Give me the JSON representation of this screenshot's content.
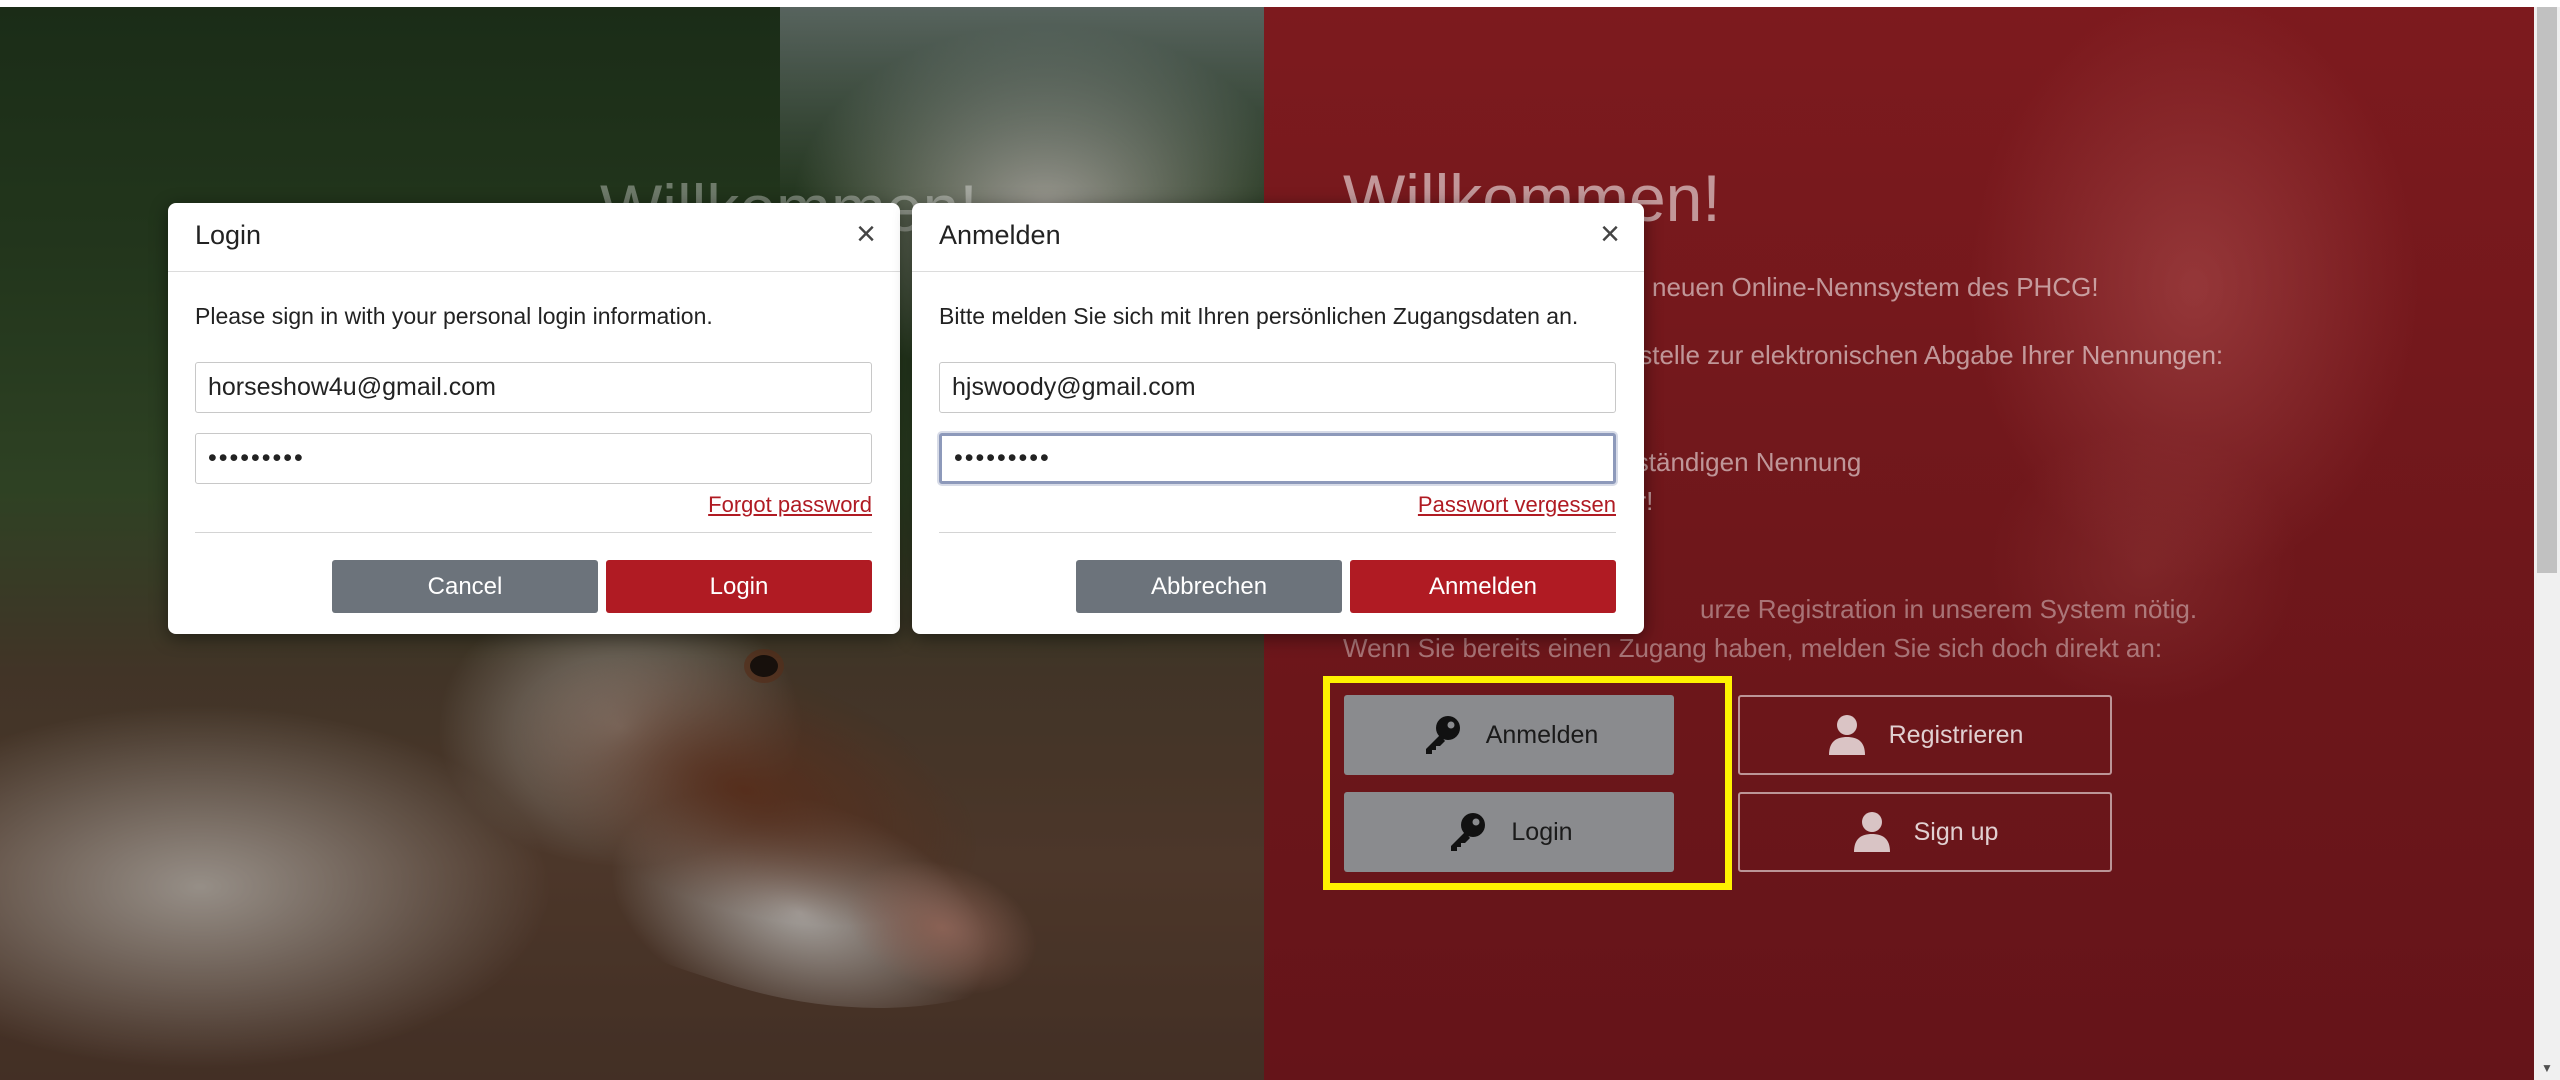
{
  "background": {
    "left_title": "Willkommen!",
    "welcome_title": "Willkommen!",
    "welcome_lines": [
      "neuen Online-Nennsystem des PHCG!",
      "fstelle zur elektronischen Abgabe Ihrer Nennungen:",
      "lständigen Nennung",
      "hr!",
      "urze Registration in unserem System nötig.",
      "Wenn Sie bereits einen Zugang haben, melden Sie sich doch direkt an:"
    ],
    "buttons": {
      "anmelden": "Anmelden",
      "login": "Login",
      "registrieren": "Registrieren",
      "signup": "Sign up"
    },
    "colors": {
      "red_panel": "#6f171b",
      "highlight": "#fff200"
    }
  },
  "login_modal": {
    "title": "Login",
    "close_glyph": "×",
    "message": "Please sign in with your personal login information.",
    "email_value": "horseshow4u@gmail.com",
    "password_value": "•••••••••",
    "forgot_link": "Forgot password",
    "cancel_label": "Cancel",
    "submit_label": "Login"
  },
  "anmelden_modal": {
    "title": "Anmelden",
    "close_glyph": "×",
    "message": "Bitte melden Sie sich mit Ihren persönlichen Zugangsdaten an.",
    "email_value": "hjswoody@gmail.com",
    "password_value": "•••••••••",
    "forgot_link": "Passwort vergessen",
    "cancel_label": "Abbrechen",
    "submit_label": "Anmelden"
  },
  "theme": {
    "accent": "#b01b23",
    "secondary": "#6c737b"
  }
}
